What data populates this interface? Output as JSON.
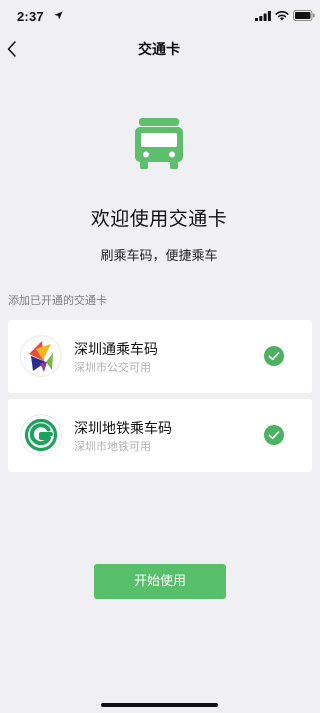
{
  "status_bar": {
    "time": "2:37",
    "icons": [
      "location-arrow-icon",
      "signal-icon",
      "wifi-icon",
      "battery-icon"
    ]
  },
  "nav": {
    "back_icon": "chevron-left-icon",
    "title": "交通卡"
  },
  "hero": {
    "icon": "bus-icon",
    "title": "欢迎使用交通卡",
    "subtitle": "刷乘车码，便捷乘车"
  },
  "section_label": "添加已开通的交通卡",
  "cards": [
    {
      "name": "深圳通乘车码",
      "desc": "深圳市公交可用",
      "logo": "shenzhen-tong-logo",
      "checked": true
    },
    {
      "name": "深圳地铁乘车码",
      "desc": "深圳市地铁可用",
      "logo": "shenzhen-metro-logo",
      "checked": true
    }
  ],
  "primary_button": {
    "label": "开始使用"
  },
  "colors": {
    "accent": "#57be6a",
    "check": "#4cb160",
    "bus": "#5dbf6b",
    "background": "#efeff4",
    "card": "#ffffff",
    "secondary_text": "#b2b2b2"
  }
}
